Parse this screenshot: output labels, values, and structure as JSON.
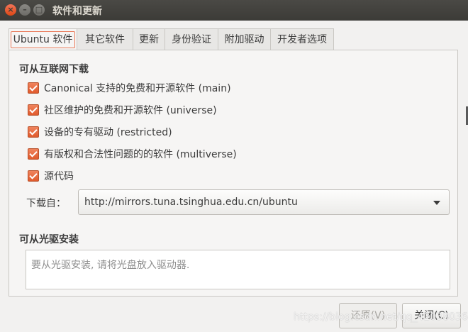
{
  "window": {
    "title": "软件和更新",
    "close": "×",
    "minimize": "–",
    "maximize": "□"
  },
  "tabs": [
    {
      "label": "Ubuntu 软件",
      "active": true
    },
    {
      "label": "其它软件"
    },
    {
      "label": "更新"
    },
    {
      "label": "身份验证"
    },
    {
      "label": "附加驱动"
    },
    {
      "label": "开发者选项"
    }
  ],
  "internet": {
    "title": "可从互联网下载",
    "options": [
      {
        "label": "Canonical 支持的免费和开源软件 (main)",
        "checked": true
      },
      {
        "label": "社区维护的免费和开源软件 (universe)",
        "checked": true
      },
      {
        "label": "设备的专有驱动 (restricted)",
        "checked": true
      },
      {
        "label": "有版权和合法性问题的的软件 (multiverse)",
        "checked": true
      },
      {
        "label": "源代码",
        "checked": true
      }
    ],
    "download_from_label": "下载自：",
    "download_from_value": "http://mirrors.tuna.tsinghua.edu.cn/ubuntu"
  },
  "cdrom": {
    "title": "可从光驱安装",
    "placeholder": "要从光驱安装, 请将光盘放入驱动器."
  },
  "buttons": {
    "revert": "还原(V)",
    "close": "关闭(C)"
  },
  "watermark": "https://blog.csdn.net/qq_42038036",
  "colors": {
    "accent": "#e05a2c",
    "titlebar": "#3c3b37"
  }
}
